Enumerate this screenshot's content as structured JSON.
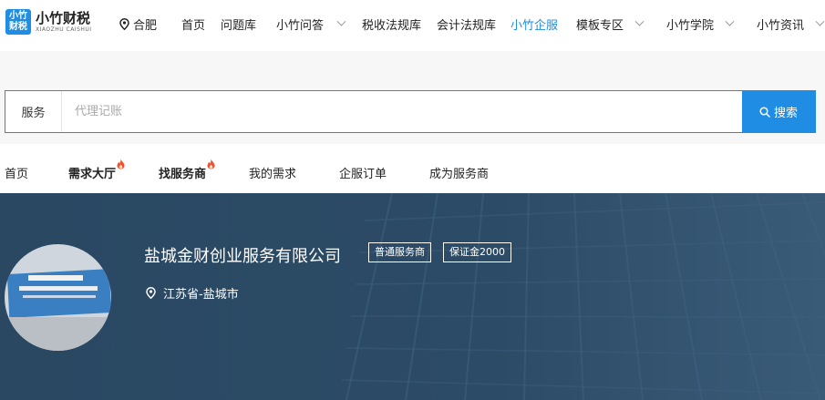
{
  "header": {
    "logo_badge_line1": "小竹",
    "logo_badge_line2": "财税",
    "logo_title": "小竹财税",
    "logo_subtitle": "XIAOZHU CAISHUI",
    "city": "合肥",
    "nav": [
      {
        "label": "首页",
        "has_dropdown": false,
        "active": false
      },
      {
        "label": "问题库",
        "has_dropdown": false,
        "active": false
      },
      {
        "label": "小竹问答",
        "has_dropdown": true,
        "active": false
      },
      {
        "label": "税收法规库",
        "has_dropdown": false,
        "active": false
      },
      {
        "label": "会计法规库",
        "has_dropdown": false,
        "active": false
      },
      {
        "label": "小竹企服",
        "has_dropdown": false,
        "active": true
      },
      {
        "label": "模板专区",
        "has_dropdown": true,
        "active": false
      },
      {
        "label": "小竹学院",
        "has_dropdown": true,
        "active": false
      },
      {
        "label": "小竹资讯",
        "has_dropdown": true,
        "active": false
      }
    ]
  },
  "search": {
    "type_label": "服务",
    "placeholder": "代理记账",
    "button_label": "搜索"
  },
  "subnav": [
    {
      "label": "首页",
      "bold": false,
      "hot": false
    },
    {
      "label": "需求大厅",
      "bold": true,
      "hot": true
    },
    {
      "label": "找服务商",
      "bold": true,
      "hot": true
    },
    {
      "label": "我的需求",
      "bold": false,
      "hot": false
    },
    {
      "label": "企服订单",
      "bold": false,
      "hot": false
    },
    {
      "label": "成为服务商",
      "bold": false,
      "hot": false
    }
  ],
  "provider": {
    "name": "盐城金财创业服务有限公司",
    "tags": [
      "普通服务商",
      "保证金2000"
    ],
    "location": "江苏省-盐城市"
  },
  "colors": {
    "accent": "#1f8de3",
    "banner": "#2b4a63",
    "hot": "#f0502a"
  }
}
